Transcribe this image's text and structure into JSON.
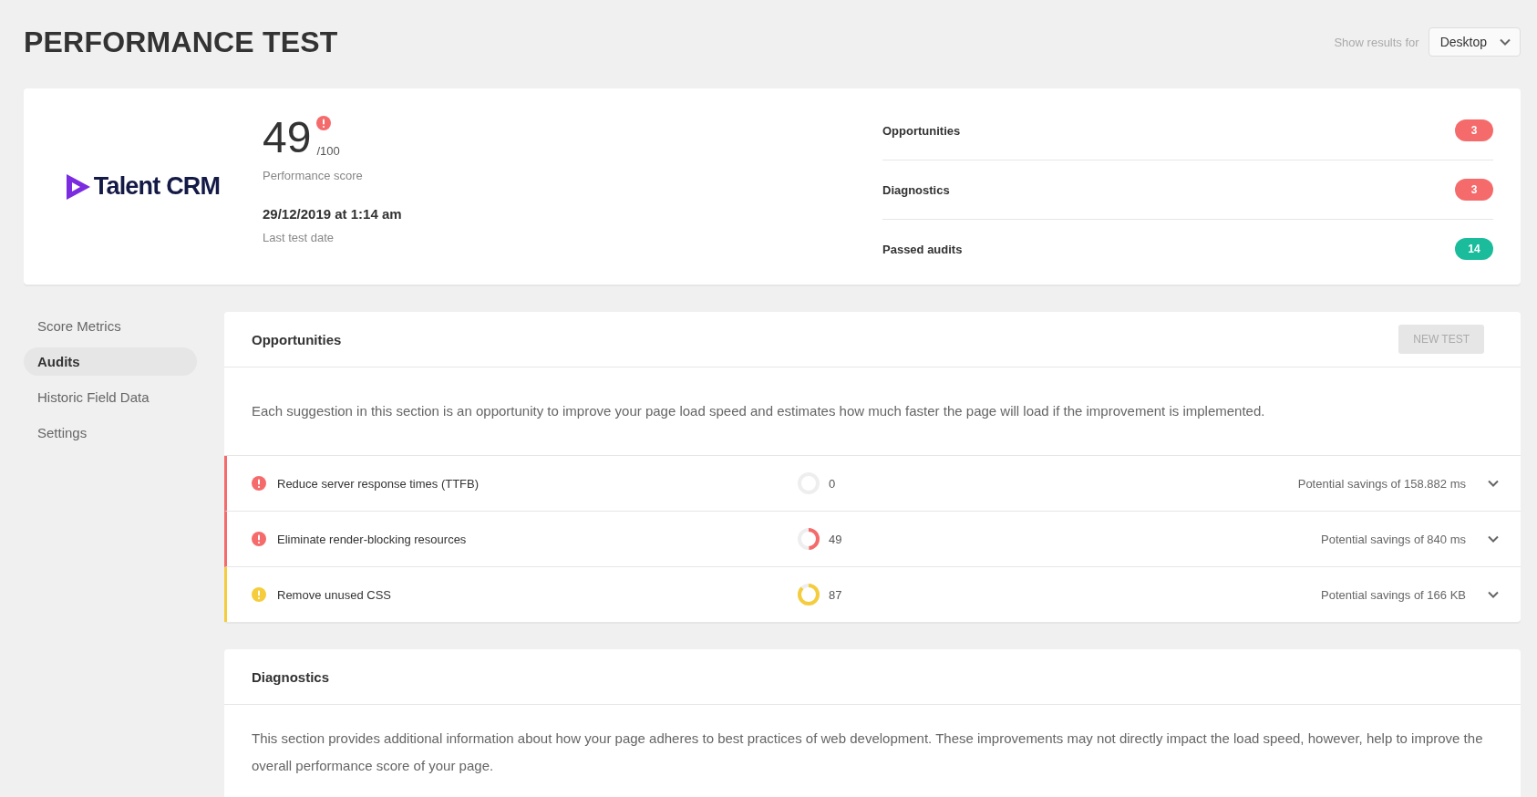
{
  "page_title": "PERFORMANCE TEST",
  "results_for": {
    "label": "Show results for",
    "value": "Desktop"
  },
  "summary": {
    "logo_text": "Talent CRM",
    "score": "49",
    "score_max": "/100",
    "score_label": "Performance score",
    "score_alert": true,
    "test_date": "29/12/2019 at 1:14 am",
    "test_date_label": "Last test date",
    "counts": [
      {
        "label": "Opportunities",
        "count": "3",
        "color": "#f56b6b"
      },
      {
        "label": "Diagnostics",
        "count": "3",
        "color": "#f56b6b"
      },
      {
        "label": "Passed audits",
        "count": "14",
        "color": "#1abc9c"
      }
    ]
  },
  "sidebar": {
    "items": [
      {
        "label": "Score Metrics",
        "selected": false
      },
      {
        "label": "Audits",
        "selected": true
      },
      {
        "label": "Historic Field Data",
        "selected": false
      },
      {
        "label": "Settings",
        "selected": false
      }
    ]
  },
  "opportunities": {
    "title": "Opportunities",
    "button": "NEW TEST",
    "description": "Each suggestion in this section is an opportunity to improve your page load speed and estimates how much faster the page will load if the improvement is implemented.",
    "rows": [
      {
        "kind": "error",
        "title": "Reduce server response times (TTFB)",
        "level": 0,
        "score": "0",
        "savings": "Potential savings of 158.882 ms"
      },
      {
        "kind": "error",
        "title": "Eliminate render-blocking resources",
        "level": 0.49,
        "score": "49",
        "savings": "Potential savings of 840 ms"
      },
      {
        "kind": "warning",
        "title": "Remove unused CSS",
        "level": 0.87,
        "score": "87",
        "savings": "Potential savings of 166 KB"
      }
    ]
  },
  "diagnostics": {
    "title": "Diagnostics",
    "description": "This section provides additional information about how your page adheres to best practices of web development. These improvements may not directly impact the load speed, however, help to improve the overall performance score of your page."
  }
}
